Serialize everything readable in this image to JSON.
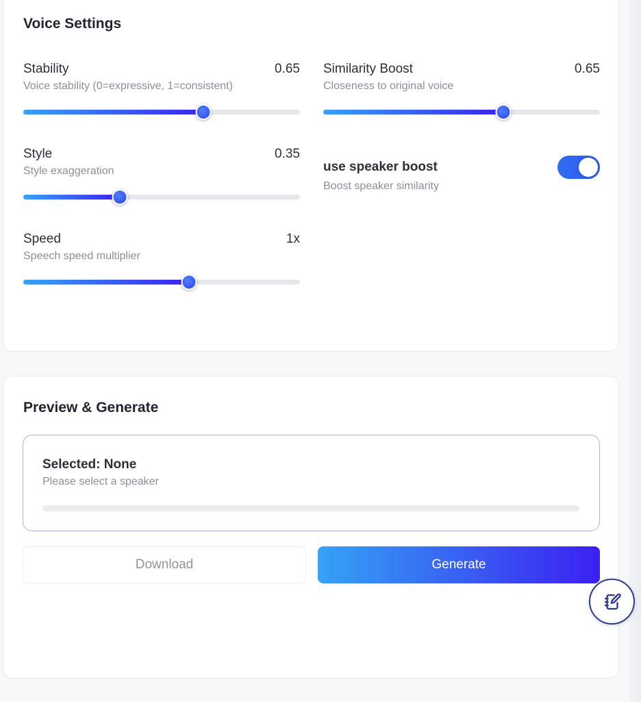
{
  "voice_settings": {
    "title": "Voice Settings",
    "stability": {
      "label": "Stability",
      "value": "0.65",
      "desc": "Voice stability (0=expressive, 1=consistent)",
      "level": 0.65
    },
    "similarity": {
      "label": "Similarity Boost",
      "value": "0.65",
      "desc": "Closeness to original voice",
      "level": 0.65
    },
    "style": {
      "label": "Style",
      "value": "0.35",
      "desc": "Style exaggeration",
      "level": 0.35
    },
    "speed": {
      "label": "Speed",
      "value": "1x",
      "desc": "Speech speed multiplier",
      "level": 0.6
    },
    "speaker_boost": {
      "label": "use speaker boost",
      "desc": "Boost speaker similarity",
      "enabled": true
    }
  },
  "preview": {
    "title": "Preview & Generate",
    "selected_title": "Selected: None",
    "selected_sub": "Please select a speaker",
    "download_label": "Download",
    "generate_label": "Generate"
  },
  "colors": {
    "accent_start": "#38a2f5",
    "accent_end": "#3b22f0",
    "toggle": "#2f6ff3"
  },
  "icons": {
    "fab": "notebook-edit-icon"
  }
}
